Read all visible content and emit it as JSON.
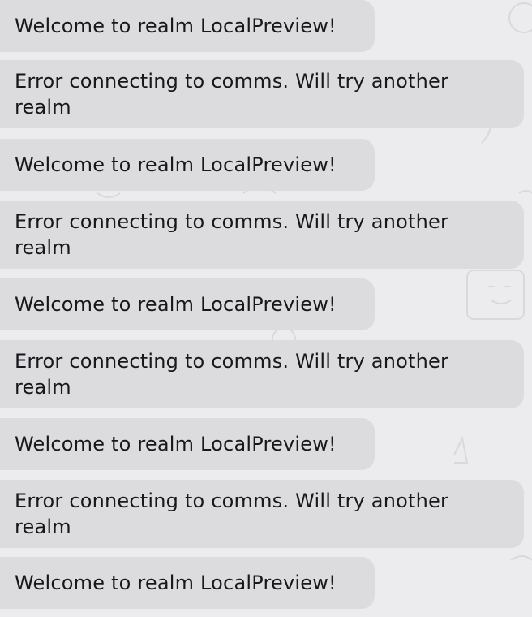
{
  "chat": {
    "messages": [
      {
        "text": "Welcome to realm LocalPreview!"
      },
      {
        "text": "Error connecting to comms. Will try another realm"
      },
      {
        "text": "Welcome to realm LocalPreview!"
      },
      {
        "text": "Error connecting to comms. Will try another realm"
      },
      {
        "text": "Welcome to realm LocalPreview!"
      },
      {
        "text": "Error connecting to comms. Will try another realm"
      },
      {
        "text": "Welcome to realm LocalPreview!"
      },
      {
        "text": "Error connecting to comms. Will try another realm"
      },
      {
        "text": "Welcome to realm LocalPreview!"
      }
    ]
  },
  "colors": {
    "background": "#ececef",
    "bubble": "#dcdcdf",
    "text": "#18181c"
  }
}
